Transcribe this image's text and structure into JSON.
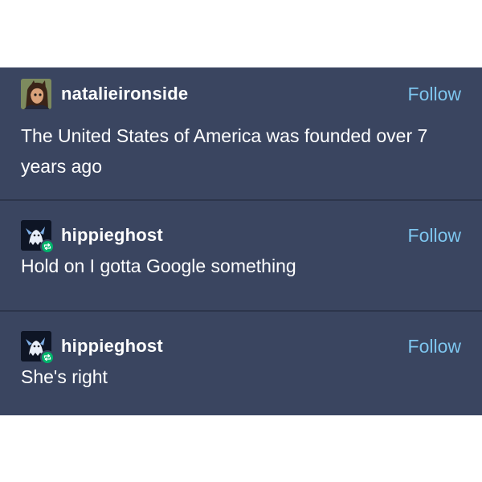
{
  "posts": [
    {
      "username": "natalieironside",
      "follow_label": "Follow",
      "text": "The United States of America was founded over 7 years ago",
      "avatar_icon": "cartoon-character-avatar"
    },
    {
      "username": "hippieghost",
      "follow_label": "Follow",
      "text": "Hold on I gotta Google something",
      "avatar_icon": "ghost-avatar",
      "badge_icon": "reblog-icon"
    },
    {
      "username": "hippieghost",
      "follow_label": "Follow",
      "text": "She's right",
      "avatar_icon": "ghost-avatar",
      "badge_icon": "reblog-icon"
    }
  ],
  "colors": {
    "panel": "#3a4560",
    "divider": "#2c354b",
    "follow": "#7ec6ef",
    "reblog": "#00b36b",
    "text": "#ffffff"
  }
}
